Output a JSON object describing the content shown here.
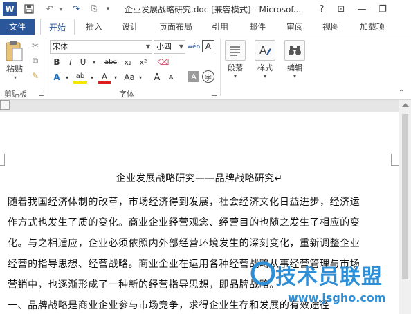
{
  "titlebar": {
    "title": "企业发展战略研究.doc [兼容模式] - Microsof...",
    "help": "?",
    "ribbon_display": "⊡",
    "minimize": "—",
    "restore": "❐"
  },
  "tabs": [
    {
      "label": "文件"
    },
    {
      "label": "开始"
    },
    {
      "label": "插入"
    },
    {
      "label": "设计"
    },
    {
      "label": "页面布局"
    },
    {
      "label": "引用"
    },
    {
      "label": "邮件"
    },
    {
      "label": "审阅"
    },
    {
      "label": "视图"
    },
    {
      "label": "加载项"
    }
  ],
  "ribbon": {
    "clipboard": {
      "paste_label": "粘贴",
      "group_label": "剪贴板"
    },
    "font": {
      "font_name": "宋体",
      "font_size": "小四",
      "group_label": "字体",
      "bold": "B",
      "italic": "I",
      "underline": "U",
      "strikethrough": "abc",
      "subscript": "x₂",
      "superscript": "x²",
      "text_effects": "A",
      "highlight": "ab",
      "font_color": "A",
      "change_case": "Aa",
      "grow_font": "A",
      "shrink_font": "A",
      "phonetic": "wén",
      "char_border": "A",
      "char_shading": "A",
      "enclose": "字"
    },
    "paragraph": {
      "label": "段落"
    },
    "styles": {
      "label": "样式"
    },
    "editing": {
      "label": "编辑"
    }
  },
  "document": {
    "title": "企业发展战略研究——品牌战略研究↵",
    "lines": [
      "随着我国经济体制的改革，市场经济得到发展，社会经济文化日益进步，经济运",
      "作方式也发生了质的变化。商业企业经营观念、经营目的也随之发生了相应的变",
      "化。与之相适应，企业必须依照内外部经营环境发生的深刻变化，重新调整企业",
      "经营的指导思想、经营战略。商业企业在运用各种经营战略从事经营管理与市场",
      "营销中，也逐渐形成了一种新的经营指导思想，即品牌战略。",
      "一、品牌战略是商业企业参与市场竞争，求得企业生存和发展的有效途径"
    ]
  },
  "watermark": {
    "main": "技术员联盟",
    "sub": "www.jsgho.com"
  },
  "colors": {
    "accent": "#2b579a",
    "watermark": "#2f8fd6"
  }
}
